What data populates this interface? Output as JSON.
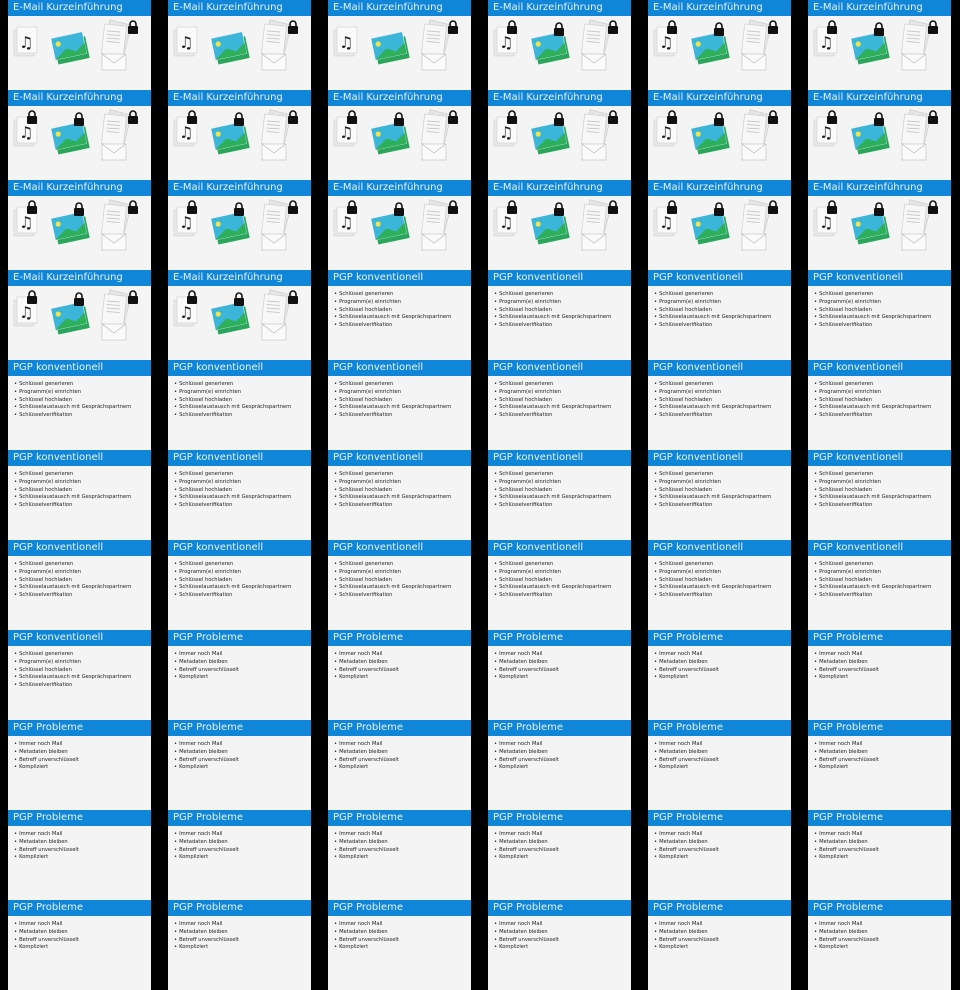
{
  "slide_types": {
    "intro": {
      "title": "E-Mail Kurzeinführung",
      "icons": [
        "music-document-icon",
        "image-icon",
        "document-icon",
        "envelope-icon",
        "lock-icon"
      ]
    },
    "pgp": {
      "title": "PGP konventionell",
      "bullets": [
        "Schlüssel generieren",
        "Programm(e) einrichten",
        "Schlüssel hochladen",
        "Schlüsselaustausch mit Gesprächspartnern",
        "Schlüsselverifikation"
      ]
    },
    "problems": {
      "title": "PGP Probleme",
      "bullets": [
        "Immer noch Mail",
        "Metadaten bleiben",
        "Betreff unverschlüsselt",
        "Kompliziert"
      ]
    }
  },
  "colors": {
    "header": "#1086d8",
    "slide_bg": "#f4f4f4",
    "background": "#000000"
  },
  "slides": [
    {
      "type": "intro",
      "locks": [
        "document"
      ]
    },
    {
      "type": "intro",
      "locks": [
        "document"
      ]
    },
    {
      "type": "intro",
      "locks": [
        "document"
      ]
    },
    {
      "type": "intro",
      "locks": [
        "music",
        "image",
        "document"
      ]
    },
    {
      "type": "intro",
      "locks": [
        "music",
        "image",
        "document"
      ]
    },
    {
      "type": "intro",
      "locks": [
        "music",
        "image",
        "document"
      ]
    },
    {
      "type": "intro",
      "locks": [
        "music",
        "image",
        "document"
      ]
    },
    {
      "type": "intro",
      "locks": [
        "music",
        "image",
        "document"
      ]
    },
    {
      "type": "intro",
      "locks": [
        "music",
        "image",
        "document"
      ]
    },
    {
      "type": "intro",
      "locks": [
        "music",
        "image",
        "document"
      ]
    },
    {
      "type": "intro",
      "locks": [
        "music",
        "image",
        "document"
      ]
    },
    {
      "type": "intro",
      "locks": [
        "music",
        "image",
        "document"
      ]
    },
    {
      "type": "intro",
      "locks": [
        "music",
        "image",
        "document"
      ]
    },
    {
      "type": "intro",
      "locks": [
        "music",
        "image",
        "document"
      ]
    },
    {
      "type": "intro",
      "locks": [
        "music",
        "image",
        "document"
      ]
    },
    {
      "type": "intro",
      "locks": [
        "music",
        "image",
        "document"
      ]
    },
    {
      "type": "intro",
      "locks": [
        "music",
        "image",
        "document"
      ]
    },
    {
      "type": "intro",
      "locks": [
        "music",
        "image",
        "document"
      ]
    },
    {
      "type": "intro",
      "locks": [
        "music",
        "image",
        "document"
      ]
    },
    {
      "type": "intro",
      "locks": [
        "music",
        "image",
        "document"
      ]
    },
    {
      "type": "pgp"
    },
    {
      "type": "pgp"
    },
    {
      "type": "pgp"
    },
    {
      "type": "pgp"
    },
    {
      "type": "pgp"
    },
    {
      "type": "pgp"
    },
    {
      "type": "pgp"
    },
    {
      "type": "pgp"
    },
    {
      "type": "pgp"
    },
    {
      "type": "pgp"
    },
    {
      "type": "pgp"
    },
    {
      "type": "pgp"
    },
    {
      "type": "pgp"
    },
    {
      "type": "pgp"
    },
    {
      "type": "pgp"
    },
    {
      "type": "pgp"
    },
    {
      "type": "pgp"
    },
    {
      "type": "pgp"
    },
    {
      "type": "pgp"
    },
    {
      "type": "pgp"
    },
    {
      "type": "pgp"
    },
    {
      "type": "pgp"
    },
    {
      "type": "pgp"
    },
    {
      "type": "problems"
    },
    {
      "type": "problems"
    },
    {
      "type": "problems"
    },
    {
      "type": "problems"
    },
    {
      "type": "problems"
    },
    {
      "type": "problems"
    },
    {
      "type": "problems"
    },
    {
      "type": "problems"
    },
    {
      "type": "problems"
    },
    {
      "type": "problems"
    },
    {
      "type": "problems"
    },
    {
      "type": "problems"
    },
    {
      "type": "problems"
    },
    {
      "type": "problems"
    },
    {
      "type": "problems"
    },
    {
      "type": "problems"
    },
    {
      "type": "problems"
    },
    {
      "type": "problems"
    },
    {
      "type": "problems"
    },
    {
      "type": "problems"
    },
    {
      "type": "problems"
    },
    {
      "type": "problems"
    },
    {
      "type": "problems"
    }
  ]
}
